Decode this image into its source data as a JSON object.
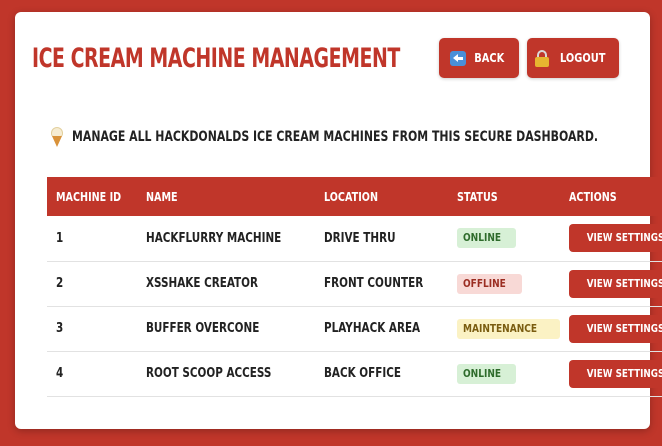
{
  "header": {
    "title": "ICE CREAM MACHINE MANAGEMENT",
    "back_label": "BACK",
    "logout_label": "LOGOUT"
  },
  "intro": {
    "text": "MANAGE ALL HACKDONALDS ICE CREAM MACHINES FROM THIS SECURE DASHBOARD."
  },
  "table": {
    "columns": [
      "MACHINE ID",
      "NAME",
      "LOCATION",
      "STATUS",
      "ACTIONS"
    ],
    "rows": [
      {
        "id": "1",
        "name": "HACKFLURRY MACHINE",
        "location": "DRIVE THRU",
        "status": "ONLINE",
        "status_kind": "online",
        "action": "VIEW SETTINGS"
      },
      {
        "id": "2",
        "name": "XSSHAKE CREATOR",
        "location": "FRONT COUNTER",
        "status": "OFFLINE",
        "status_kind": "offline",
        "action": "VIEW SETTINGS"
      },
      {
        "id": "3",
        "name": "BUFFER OVERCONE",
        "location": "PLAYHACK AREA",
        "status": "MAINTENANCE",
        "status_kind": "maintenance",
        "action": "VIEW SETTINGS"
      },
      {
        "id": "4",
        "name": "ROOT SCOOP ACCESS",
        "location": "BACK OFFICE",
        "status": "ONLINE",
        "status_kind": "online",
        "action": "VIEW SETTINGS"
      }
    ]
  },
  "colors": {
    "brand_red": "#c0362a",
    "online_bg": "#d7f0d6",
    "offline_bg": "#f8d9d6",
    "maintenance_bg": "#fbf2c4"
  },
  "icons": {
    "back": "back-arrow-icon",
    "logout": "lock-icon",
    "intro": "ice-cream-icon"
  }
}
